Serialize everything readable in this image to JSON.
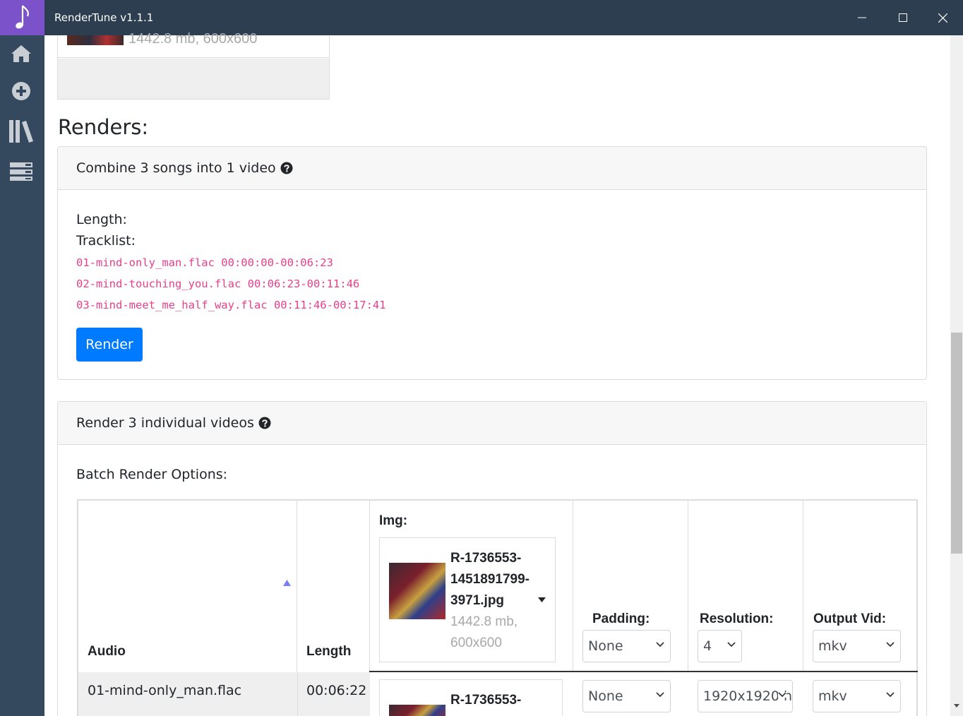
{
  "window": {
    "title": "RenderTune v1.1.1",
    "controls": [
      "minimize",
      "maximize",
      "close"
    ]
  },
  "sidebar": {
    "items": [
      {
        "icon": "home-icon"
      },
      {
        "icon": "plus-circle-icon"
      },
      {
        "icon": "library-icon"
      },
      {
        "icon": "list-icon"
      }
    ]
  },
  "top_image_card": {
    "meta": "1442.8 mb, 600x600"
  },
  "renders": {
    "title": "Renders:",
    "combine": {
      "header": "Combine 3 songs into 1 video",
      "length_label": "Length:",
      "tracklist_label": "Tracklist:",
      "tracks": [
        "01-mind-only_man.flac 00:00:00-00:06:23",
        "02-mind-touching_you.flac 00:06:23-00:11:46",
        "03-mind-meet_me_half_way.flac 00:11:46-00:17:41"
      ],
      "render_button": "Render"
    },
    "individual": {
      "header": "Render 3 individual videos",
      "batch_label": "Batch Render Options:",
      "columns": {
        "audio": "Audio",
        "length": "Length",
        "img": "Img:",
        "padding": "Padding:",
        "resolution": "Resolution:",
        "output": "Output Vid:"
      },
      "batch": {
        "img_name": "R-1736553-1451891799-3971.jpg",
        "img_name_lines": [
          "R-1736553-",
          "1451891799-",
          "3971.jpg"
        ],
        "img_meta_lines": [
          "1442.8 mb,",
          "600x600"
        ],
        "padding": "None",
        "resolution": "4",
        "output": "mkv"
      },
      "rows": [
        {
          "audio": "01-mind-only_man.flac",
          "length": "00:06:22",
          "img_name": "R-1736553-",
          "padding": "None",
          "resolution": "1920x1920 h",
          "output": "mkv"
        }
      ]
    }
  },
  "colors": {
    "titlebar": "#2c3e50",
    "sidebar": "#34495e",
    "logo": "#7b52c9",
    "primary": "#007bff",
    "code": "#e83e8c"
  }
}
